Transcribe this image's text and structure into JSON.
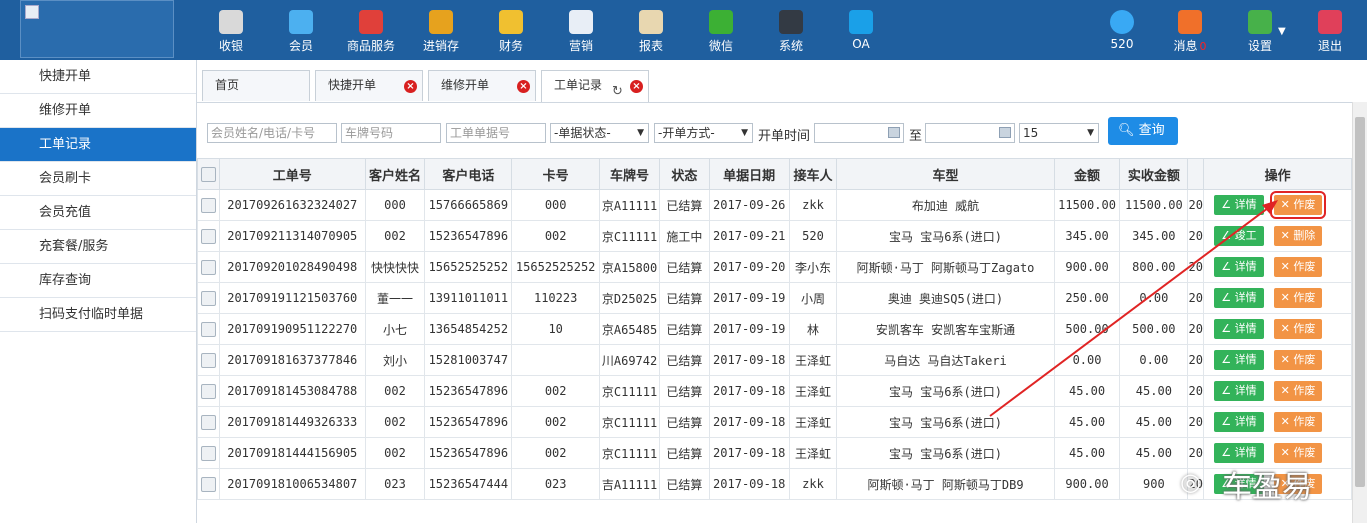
{
  "topnav": [
    {
      "label": "收银",
      "color": "#d9d9d9",
      "icon": "cash-register-icon"
    },
    {
      "label": "会员",
      "color": "#4cb0f0",
      "icon": "member-icon"
    },
    {
      "label": "商品服务",
      "color": "#e0403a",
      "icon": "goods-service-icon"
    },
    {
      "label": "进销存",
      "color": "#e6a21e",
      "icon": "inventory-icon"
    },
    {
      "label": "财务",
      "color": "#f0c030",
      "icon": "finance-icon"
    },
    {
      "label": "营销",
      "color": "#e8eef6",
      "icon": "megaphone-icon"
    },
    {
      "label": "报表",
      "color": "#e8d7b0",
      "icon": "report-icon"
    },
    {
      "label": "微信",
      "color": "#3cb034",
      "icon": "wechat-icon"
    },
    {
      "label": "系统",
      "color": "#333a44",
      "icon": "monitor-icon"
    },
    {
      "label": "OA",
      "color": "#1aa0e8",
      "icon": "oa-icon"
    }
  ],
  "user": {
    "label": "520",
    "color": "#39a9f4"
  },
  "messages": {
    "label": "消息",
    "count": "0",
    "color": "#f0702a"
  },
  "settings": {
    "label": "设置",
    "color": "#47b14a"
  },
  "logout": {
    "label": "退出",
    "color": "#e0405a"
  },
  "sidebar": {
    "items": [
      "快捷开单",
      "维修开单",
      "工单记录",
      "会员刷卡",
      "会员充值",
      "充套餐/服务",
      "库存查询",
      "扫码支付临时单据"
    ],
    "active": 2
  },
  "tabs": [
    {
      "label": "首页"
    },
    {
      "label": "快捷开单"
    },
    {
      "label": "维修开单"
    },
    {
      "label": "工单记录"
    }
  ],
  "filters": {
    "name_phone_card_placeholder": "会员姓名/电话/卡号",
    "plate_placeholder": "车牌号码",
    "order_no_placeholder": "工单单据号",
    "status_select": "-单据状态-",
    "method_select": "-开单方式-",
    "time_label": "开单时间",
    "to_label": "至",
    "page_size": "15",
    "query_label": "查询"
  },
  "table": {
    "headers": [
      "工单号",
      "客户姓名",
      "客户电话",
      "卡号",
      "车牌号",
      "状态",
      "单据日期",
      "接车人",
      "车型",
      "金额",
      "实收金额",
      "",
      "操作"
    ],
    "rows": [
      [
        "201709261632324027",
        "000",
        "15766665869",
        "000",
        "京A11111",
        "已结算",
        "2017-09-26",
        "zkk",
        "布加迪 威航",
        "11500.00",
        "11500.00",
        "20",
        "详情",
        "作废"
      ],
      [
        "201709211314070905",
        "002",
        "15236547896",
        "002",
        "京C11111",
        "施工中",
        "2017-09-21",
        "520",
        "宝马 宝马6系(进口)",
        "345.00",
        "345.00",
        "20",
        "竣工",
        "删除"
      ],
      [
        "201709201028490498",
        "快快快快",
        "15652525252",
        "15652525252",
        "京A15800",
        "已结算",
        "2017-09-20",
        "李小东",
        "阿斯顿·马丁 阿斯顿马丁Zagato",
        "900.00",
        "800.00",
        "20",
        "详情",
        "作废"
      ],
      [
        "201709191121503760",
        "董一一",
        "13911011011",
        "110223",
        "京D25025",
        "已结算",
        "2017-09-19",
        "小周",
        "奥迪 奥迪SQ5(进口)",
        "250.00",
        "0.00",
        "20",
        "详情",
        "作废"
      ],
      [
        "201709190951122270",
        "小七",
        "13654854252",
        "10",
        "京A65485",
        "已结算",
        "2017-09-19",
        "林",
        "安凯客车 安凯客车宝斯通",
        "500.00",
        "500.00",
        "20",
        "详情",
        "作废"
      ],
      [
        "201709181637377846",
        "刘小",
        "15281003747",
        "",
        "川A69742",
        "已结算",
        "2017-09-18",
        "王泽虹",
        "马自达 马自达Takeri",
        "0.00",
        "0.00",
        "20",
        "详情",
        "作废"
      ],
      [
        "201709181453084788",
        "002",
        "15236547896",
        "002",
        "京C11111",
        "已结算",
        "2017-09-18",
        "王泽虹",
        "宝马 宝马6系(进口)",
        "45.00",
        "45.00",
        "20",
        "详情",
        "作废"
      ],
      [
        "201709181449326333",
        "002",
        "15236547896",
        "002",
        "京C11111",
        "已结算",
        "2017-09-18",
        "王泽虹",
        "宝马 宝马6系(进口)",
        "45.00",
        "45.00",
        "20",
        "详情",
        "作废"
      ],
      [
        "201709181444156905",
        "002",
        "15236547896",
        "002",
        "京C11111",
        "已结算",
        "2017-09-18",
        "王泽虹",
        "宝马 宝马6系(进口)",
        "45.00",
        "45.00",
        "20",
        "详情",
        "作废"
      ],
      [
        "201709181006534807",
        "023",
        "15236547444",
        "023",
        "吉A11111",
        "已结算",
        "2017-09-18",
        "zkk",
        "阿斯顿·马丁 阿斯顿马丁DB9",
        "900.00",
        "900",
        "20",
        "详情",
        "作废"
      ]
    ]
  },
  "watermark": "车盈易",
  "colors": {
    "topbar": "#1f5f9f",
    "accent": "#1a73c8",
    "green_btn": "#33b35a",
    "orange_btn": "#f29445",
    "highlight": "#e02424"
  }
}
